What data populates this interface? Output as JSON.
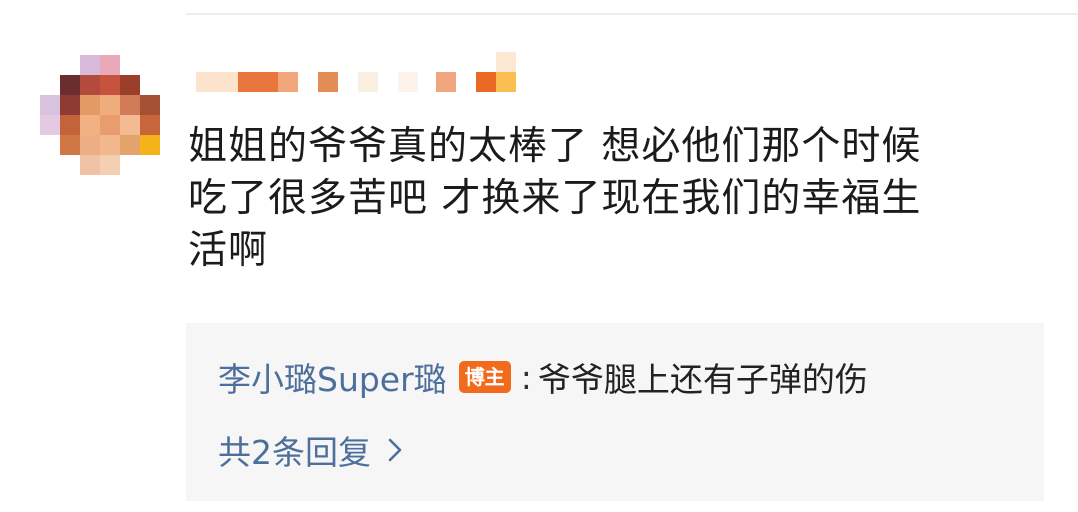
{
  "comment": {
    "text": "姐姐的爷爷真的太棒了 想必他们那个时候\n吃了很多苦吧 才换来了现在我们的幸福生\n活啊"
  },
  "reply": {
    "author": "李小璐Super璐",
    "badge": "博主",
    "separator": ":",
    "content": "爷爷腿上还有子弹的伤"
  },
  "more_replies": {
    "label": "共2条回复"
  },
  "icons": {
    "more_replies_icon": "chevron-right-icon"
  },
  "colors": {
    "link_blue": "#4c6f9c",
    "badge_orange": "#f26b1d",
    "reply_bg": "#f6f6f6",
    "text": "#1b1b1b"
  }
}
